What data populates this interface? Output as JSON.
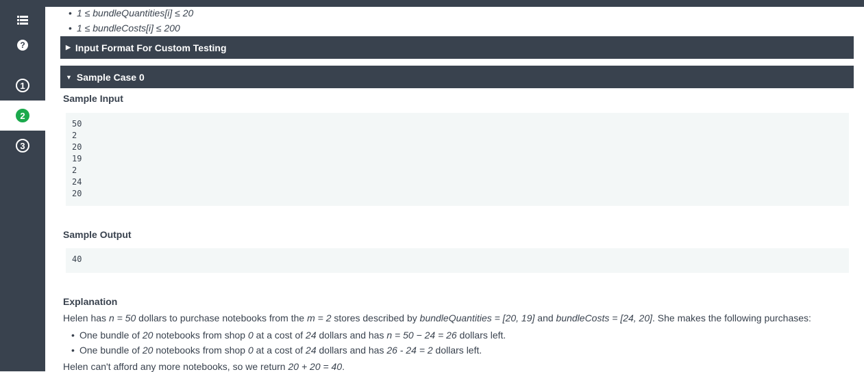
{
  "sidebar": {
    "questions": [
      "1",
      "2",
      "3"
    ],
    "active_question": "2",
    "help_glyph": "?"
  },
  "constraints": [
    {
      "min": "1",
      "sym": "≤",
      "expr": "bundleQuantities[i]",
      "max": "20"
    },
    {
      "min": "1",
      "sym": "≤",
      "expr": "bundleCosts[i]",
      "max": "200"
    }
  ],
  "sections": {
    "input_format": {
      "label": "Input Format For Custom Testing",
      "state": "collapsed"
    },
    "sample_case": {
      "label": "Sample Case 0",
      "state": "expanded"
    }
  },
  "sample": {
    "input_label": "Sample Input",
    "input_lines": [
      "50",
      "2",
      "20",
      "19",
      "2",
      "24",
      "20"
    ],
    "output_label": "Sample Output",
    "output_lines": [
      "40"
    ]
  },
  "explanation": {
    "heading": "Explanation",
    "intro": {
      "t1": "Helen has ",
      "n": "n = 50",
      "t2": " dollars to purchase notebooks from the ",
      "m": "m = 2",
      "t3": " stores described by ",
      "bq": "bundleQuantities = [20, 19]",
      "t4": " and ",
      "bc": "bundleCosts = [24, 20]",
      "t5": ". She makes the following purchases:"
    },
    "items": [
      {
        "t1": "One bundle of ",
        "a": "20",
        "t2": " notebooks from shop ",
        "b": "0",
        "t3": " at a cost of ",
        "c": "24",
        "t4": " dollars and has ",
        "d": "n = 50 − 24 = 26",
        "t5": " dollars left."
      },
      {
        "t1": "One bundle of ",
        "a": "20",
        "t2": " notebooks from shop ",
        "b": "0",
        "t3": " at a cost of ",
        "c": "24",
        "t4": " dollars and has ",
        "d": "26 - 24 = 2",
        "t5": " dollars left."
      }
    ],
    "conclusion": {
      "t1": "Helen can't afford any more notebooks, so we return ",
      "r": "20 + 20 = 40",
      "t2": "."
    }
  },
  "colors": {
    "dark": "#39424e",
    "accent_green": "#1ba94c",
    "code_bg": "#f3f7f7"
  }
}
